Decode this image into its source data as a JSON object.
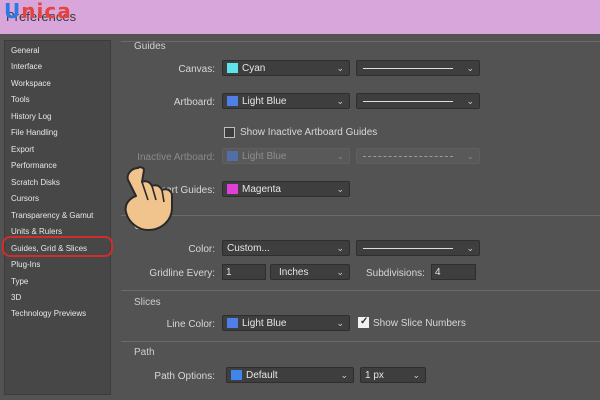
{
  "window": {
    "title": "Preferences"
  },
  "logo": {
    "first": "U",
    "rest": "nica"
  },
  "sidebar": {
    "items": [
      {
        "label": "General"
      },
      {
        "label": "Interface"
      },
      {
        "label": "Workspace"
      },
      {
        "label": "Tools"
      },
      {
        "label": "History Log"
      },
      {
        "label": "File Handling"
      },
      {
        "label": "Export"
      },
      {
        "label": "Performance"
      },
      {
        "label": "Scratch Disks"
      },
      {
        "label": "Cursors"
      },
      {
        "label": "Transparency & Gamut"
      },
      {
        "label": "Units & Rulers"
      },
      {
        "label": "Guides, Grid & Slices"
      },
      {
        "label": "Plug-Ins"
      },
      {
        "label": "Type"
      },
      {
        "label": "3D"
      },
      {
        "label": "Technology Previews"
      }
    ],
    "selected": "Guides, Grid & Slices"
  },
  "guides": {
    "section_title": "Guides",
    "canvas_label": "Canvas:",
    "canvas_color": "Cyan",
    "canvas_swatch": "#5fe3ec",
    "artboard_label": "Artboard:",
    "artboard_color": "Light Blue",
    "artboard_swatch": "#4d7fe6",
    "show_inactive_label": "Show Inactive Artboard Guides",
    "show_inactive_checked": false,
    "inactive_label": "Inactive Artboard:",
    "inactive_color": "Light Blue",
    "inactive_swatch": "#4d7fe6",
    "smart_label": "Smart Guides:",
    "smart_color": "Magenta",
    "smart_swatch": "#e040d8"
  },
  "grid": {
    "section_title": "Grid",
    "color_label": "Color:",
    "color_value": "Custom...",
    "gridline_label": "Gridline Every:",
    "gridline_value": "1",
    "units_value": "Inches",
    "subdivisions_label": "Subdivisions:",
    "subdivisions_value": "4"
  },
  "slices": {
    "section_title": "Slices",
    "line_color_label": "Line Color:",
    "line_color": "Light Blue",
    "line_swatch": "#4d7fe6",
    "show_numbers_label": "Show Slice Numbers",
    "show_numbers_checked": true
  },
  "path": {
    "section_title": "Path",
    "options_label": "Path Options:",
    "options_value": "Default",
    "options_swatch": "#3f86ea",
    "width_value": "1 px"
  },
  "icons": {
    "chevron": "chevron-down-icon",
    "pointer": "hand-pointer-icon",
    "check": "check-icon"
  }
}
